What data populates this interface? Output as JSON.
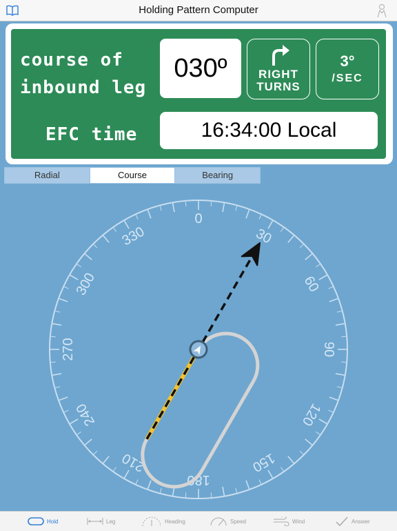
{
  "navbar": {
    "title": "Holding Pattern Computer",
    "left_icon": "book-icon",
    "right_icon": "pilot-icon"
  },
  "panel": {
    "course_label_line1": "course of",
    "course_label_line2": "inbound leg",
    "course_value": "030º",
    "turn_line1": "RIGHT",
    "turn_line2": "TURNS",
    "rate_value": "3°",
    "rate_unit": "/SEC",
    "efc_label": "EFC time",
    "efc_value": "16:34:00 Local",
    "colors": {
      "panel_green": "#2d8b57",
      "accent_yellow": "#f2c12e"
    }
  },
  "segments": {
    "items": [
      "Radial",
      "Course",
      "Bearing"
    ],
    "selected": "Course"
  },
  "compass": {
    "labels": [
      "0",
      "30",
      "60",
      "90",
      "120",
      "150",
      "180",
      "210",
      "240",
      "270",
      "300",
      "330"
    ],
    "inbound_course": 30
  },
  "tabbar": {
    "items": [
      {
        "label": "Hold",
        "icon": "hold-oval-icon",
        "active": true
      },
      {
        "label": "Leg",
        "icon": "leg-length-icon",
        "active": false
      },
      {
        "label": "Heading",
        "icon": "heading-dial-icon",
        "active": false
      },
      {
        "label": "Speed",
        "icon": "speed-gauge-icon",
        "active": false
      },
      {
        "label": "Wind",
        "icon": "wind-icon",
        "active": false
      },
      {
        "label": "Answer",
        "icon": "checkmark-icon",
        "active": false
      }
    ]
  }
}
